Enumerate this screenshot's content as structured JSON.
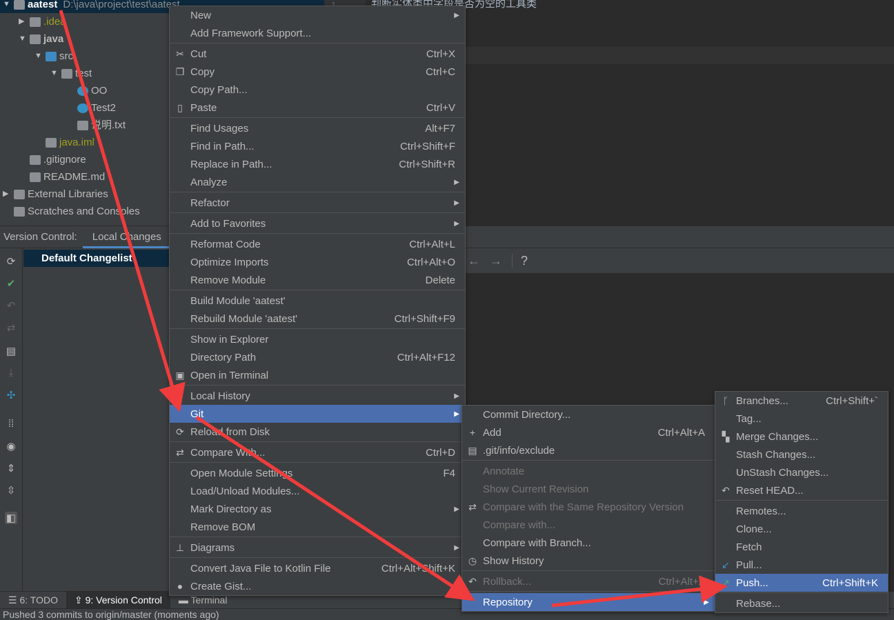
{
  "project_tree": [
    {
      "label": "aatest",
      "path": "D:\\java\\project\\test\\aatest",
      "level": 0,
      "expanded": true,
      "selected": true,
      "icon": "module-folder-icon"
    },
    {
      "label": ".idea",
      "level": 1,
      "expanded": false,
      "color": "#a0a020",
      "icon": "folder-icon"
    },
    {
      "label": "java",
      "level": 1,
      "expanded": true,
      "icon": "module-folder-icon"
    },
    {
      "label": "src",
      "level": 2,
      "expanded": true,
      "icon": "source-folder-icon"
    },
    {
      "label": "test",
      "level": 3,
      "expanded": true,
      "icon": "package-icon"
    },
    {
      "label": "OO",
      "level": 4,
      "icon": "java-class-icon"
    },
    {
      "label": "Test2",
      "level": 4,
      "icon": "java-class-icon"
    },
    {
      "label": "说明.txt",
      "level": 4,
      "icon": "text-file-icon"
    },
    {
      "label": "java.iml",
      "level": 2,
      "color": "#a0a020",
      "icon": "iml-file-icon"
    },
    {
      "label": ".gitignore",
      "level": 1,
      "icon": "gitignore-file-icon"
    },
    {
      "label": "README.md",
      "level": 1,
      "icon": "markdown-file-icon"
    },
    {
      "label": "External Libraries",
      "level": 0,
      "expanded": false,
      "icon": "libraries-icon"
    },
    {
      "label": "Scratches and Consoles",
      "level": 0,
      "icon": "scratches-icon"
    }
  ],
  "editor": {
    "line_number": "1",
    "text": "判断实体类中字段是否为空的工具类"
  },
  "version_control": {
    "label": "Version Control:",
    "tab": "Local Changes",
    "changelist": "Default Changelist"
  },
  "bottom_tabs": [
    "6: TODO",
    "9: Version Control",
    "Terminal"
  ],
  "status": "Pushed 3 commits to origin/master (moments ago)",
  "context_menu": [
    {
      "label": "New",
      "submenu": true
    },
    {
      "label": "Add Framework Support..."
    },
    {
      "sep": true
    },
    {
      "label": "Cut",
      "shortcut": "Ctrl+X",
      "icon": "✂",
      "icon_name": "scissors-icon"
    },
    {
      "label": "Copy",
      "shortcut": "Ctrl+C",
      "icon": "❐",
      "icon_name": "copy-icon"
    },
    {
      "label": "Copy Path..."
    },
    {
      "label": "Paste",
      "shortcut": "Ctrl+V",
      "icon": "▯",
      "icon_name": "clipboard-icon"
    },
    {
      "sep": true
    },
    {
      "label": "Find Usages",
      "shortcut": "Alt+F7"
    },
    {
      "label": "Find in Path...",
      "shortcut": "Ctrl+Shift+F"
    },
    {
      "label": "Replace in Path...",
      "shortcut": "Ctrl+Shift+R"
    },
    {
      "label": "Analyze",
      "submenu": true
    },
    {
      "sep": true
    },
    {
      "label": "Refactor",
      "submenu": true
    },
    {
      "sep": true
    },
    {
      "label": "Add to Favorites",
      "submenu": true
    },
    {
      "sep": true
    },
    {
      "label": "Reformat Code",
      "shortcut": "Ctrl+Alt+L"
    },
    {
      "label": "Optimize Imports",
      "shortcut": "Ctrl+Alt+O"
    },
    {
      "label": "Remove Module",
      "shortcut": "Delete"
    },
    {
      "sep": true
    },
    {
      "label": "Build Module 'aatest'"
    },
    {
      "label": "Rebuild Module 'aatest'",
      "shortcut": "Ctrl+Shift+F9"
    },
    {
      "sep": true
    },
    {
      "label": "Show in Explorer"
    },
    {
      "label": "Directory Path",
      "shortcut": "Ctrl+Alt+F12"
    },
    {
      "label": "Open in Terminal",
      "icon": "▣",
      "icon_name": "terminal-icon"
    },
    {
      "sep": true
    },
    {
      "label": "Local History",
      "submenu": true
    },
    {
      "label": "Git",
      "submenu": true,
      "highlighted": true
    },
    {
      "label": "Reload from Disk",
      "icon": "⟳",
      "icon_name": "reload-icon"
    },
    {
      "sep": true
    },
    {
      "label": "Compare With...",
      "shortcut": "Ctrl+D",
      "icon": "⇄",
      "icon_name": "compare-icon"
    },
    {
      "sep": true
    },
    {
      "label": "Open Module Settings",
      "shortcut": "F4"
    },
    {
      "label": "Load/Unload Modules..."
    },
    {
      "label": "Mark Directory as",
      "submenu": true
    },
    {
      "label": "Remove BOM"
    },
    {
      "sep": true
    },
    {
      "label": "Diagrams",
      "submenu": true,
      "icon": "⊥",
      "icon_name": "diagram-icon"
    },
    {
      "sep": true
    },
    {
      "label": "Convert Java File to Kotlin File",
      "shortcut": "Ctrl+Alt+Shift+K"
    },
    {
      "label": "Create Gist...",
      "icon": "●",
      "icon_name": "github-icon"
    }
  ],
  "git_menu": [
    {
      "label": "Commit Directory..."
    },
    {
      "label": "Add",
      "shortcut": "Ctrl+Alt+A",
      "icon": "+",
      "icon_name": "plus-icon"
    },
    {
      "label": ".git/info/exclude",
      "icon": "▤",
      "icon_name": "ignore-file-icon"
    },
    {
      "sep": true
    },
    {
      "label": "Annotate",
      "disabled": true
    },
    {
      "label": "Show Current Revision",
      "disabled": true
    },
    {
      "label": "Compare with the Same Repository Version",
      "disabled": true,
      "icon": "⇄",
      "icon_name": "compare-icon"
    },
    {
      "label": "Compare with...",
      "disabled": true
    },
    {
      "label": "Compare with Branch..."
    },
    {
      "label": "Show History",
      "icon": "◷",
      "icon_name": "clock-icon"
    },
    {
      "sep": true
    },
    {
      "label": "Rollback...",
      "shortcut": "Ctrl+Alt+Z",
      "disabled": true,
      "icon": "↶",
      "icon_name": "rollback-icon"
    },
    {
      "sep": true
    },
    {
      "label": "Repository",
      "submenu": true,
      "highlighted": true
    }
  ],
  "repository_menu": [
    {
      "label": "Branches...",
      "shortcut": "Ctrl+Shift+`",
      "icon": "ᚴ",
      "icon_name": "branch-icon"
    },
    {
      "label": "Tag..."
    },
    {
      "label": "Merge Changes...",
      "icon": "▚",
      "icon_name": "merge-icon"
    },
    {
      "label": "Stash Changes..."
    },
    {
      "label": "UnStash Changes..."
    },
    {
      "label": "Reset HEAD...",
      "icon": "↶",
      "icon_name": "reset-icon"
    },
    {
      "sep": true
    },
    {
      "label": "Remotes..."
    },
    {
      "label": "Clone..."
    },
    {
      "label": "Fetch"
    },
    {
      "label": "Pull...",
      "icon": "↙",
      "icon_name": "pull-arrow-icon",
      "icon_color": "#3592c4"
    },
    {
      "label": "Push...",
      "shortcut": "Ctrl+Shift+K",
      "highlighted": true,
      "icon": "↗",
      "icon_name": "push-arrow-icon",
      "icon_color": "#59a869"
    },
    {
      "sep": true
    },
    {
      "label": "Rebase..."
    }
  ],
  "colors": {
    "highlight": "#4b6eaf",
    "annotation_arrow": "#f03c3c",
    "selection": "#0d293e"
  }
}
